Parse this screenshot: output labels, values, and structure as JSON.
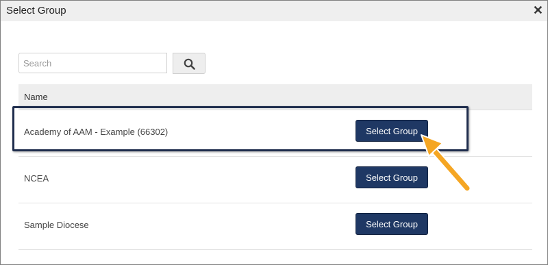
{
  "dialog": {
    "title": "Select Group",
    "close_glyph": "✕"
  },
  "search": {
    "placeholder": "Search",
    "value": "",
    "button_icon": "search-icon"
  },
  "table": {
    "header": {
      "name": "Name"
    },
    "rows": [
      {
        "label": "Academy of AAM - Example (66302)",
        "button": "Select Group"
      },
      {
        "label": "NCEA",
        "button": "Select Group"
      },
      {
        "label": "Sample Diocese",
        "button": "Select Group"
      }
    ]
  },
  "colors": {
    "button_bg": "#1f3864",
    "highlight_border": "#1f2d4d",
    "arrow": "#f5a623",
    "header_bg": "#eeeeee"
  }
}
